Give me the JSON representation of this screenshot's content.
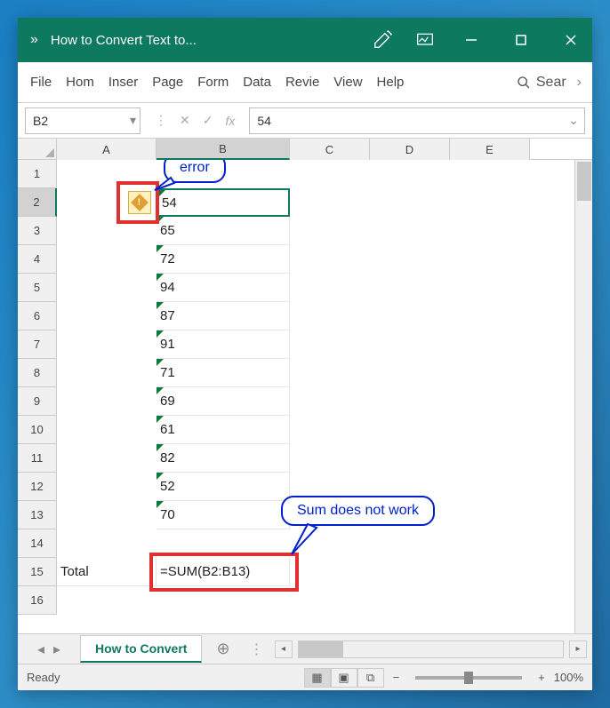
{
  "titlebar": {
    "chevron": "»",
    "title": "How to Convert Text to..."
  },
  "ribbon": {
    "tabs": [
      "File",
      "Hom",
      "Inser",
      "Page",
      "Form",
      "Data",
      "Revie",
      "View",
      "Help"
    ],
    "search": "Sear"
  },
  "formula_bar": {
    "name_box": "B2",
    "value": "54"
  },
  "columns": [
    "A",
    "B",
    "C",
    "D",
    "E"
  ],
  "rows": [
    "1",
    "2",
    "3",
    "4",
    "5",
    "6",
    "7",
    "8",
    "9",
    "10",
    "11",
    "12",
    "13",
    "14",
    "15",
    "16"
  ],
  "cells": {
    "A15": "Total",
    "B2": "54",
    "B3": "65",
    "B4": "72",
    "B5": "94",
    "B6": "87",
    "B7": "91",
    "B8": "71",
    "B9": "69",
    "B10": "61",
    "B11": "82",
    "B12": "52",
    "B13": "70",
    "B15": "=SUM(B2:B13)"
  },
  "sheet": {
    "active": "How to Convert"
  },
  "statusbar": {
    "ready": "Ready",
    "zoom": "100%"
  },
  "annotations": {
    "callout1": "error",
    "callout2": "Sum does not work"
  }
}
